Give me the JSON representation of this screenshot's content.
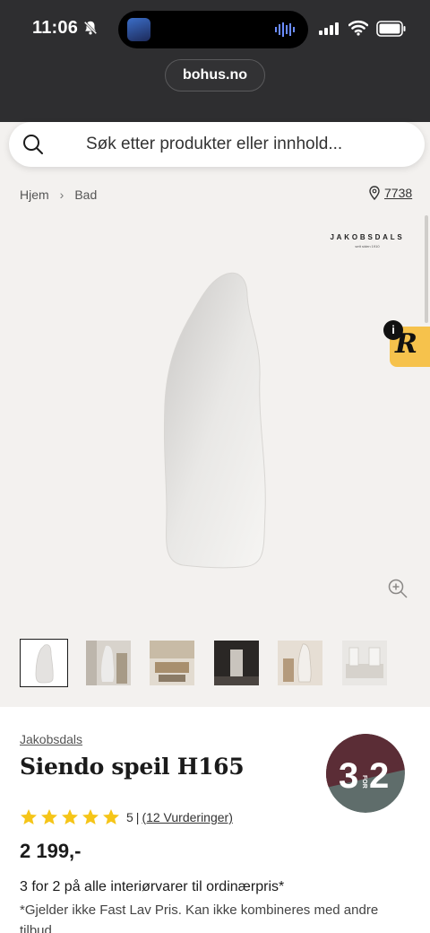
{
  "status_bar": {
    "time": "11:06",
    "icons": [
      "bell-slash-icon",
      "signal-icon",
      "wifi-icon",
      "battery-icon"
    ]
  },
  "browser": {
    "url": "bohus.no"
  },
  "search": {
    "placeholder": "Søk etter produkter eller innhold..."
  },
  "breadcrumb": {
    "items": [
      "Hjem",
      "Bad"
    ],
    "store_number": "7738"
  },
  "gallery": {
    "logo_text": "JAKOBSDALS",
    "logo_sub": "sett siden 1910",
    "thumbnail_count": 6,
    "active_thumbnail": 0
  },
  "product": {
    "brand": "Jakobsdals",
    "title": "Siendo speil H165",
    "rating_stars": 5,
    "rating_value": "5",
    "rating_separator": "|",
    "reviews_link": "(12 Vurderinger)",
    "price": "2 199,-",
    "offer": "3 for 2 på alle interiørvarer til ordinærpris*",
    "note": "*Gjelder ikke Fast Lav Pris. Kan ikke kombineres med andre tilbud"
  },
  "promo_badge": {
    "big_left": "3",
    "small": "FOR",
    "big_right": "2",
    "colors": {
      "top": "#5b2d36",
      "bottom": "#5f6d6b"
    }
  },
  "colors": {
    "header_dark": "#2e2e30",
    "page_bg": "#f3f1ef",
    "badge_yellow": "#f6c24c",
    "star": "#f5c518"
  }
}
